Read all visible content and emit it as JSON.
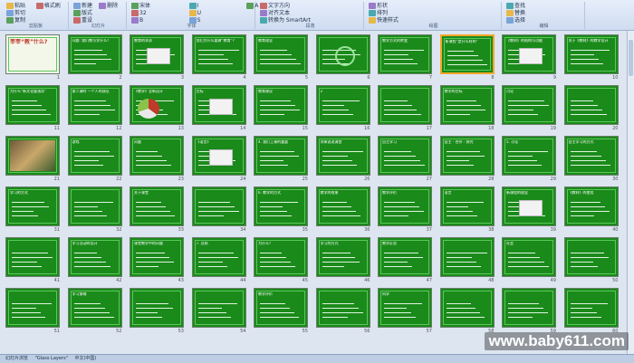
{
  "ribbon": {
    "groups": [
      {
        "label": "剪贴板",
        "buttons": [
          "粘贴",
          "剪切",
          "复制",
          "格式刷"
        ]
      },
      {
        "label": "幻灯片",
        "buttons": [
          "新建",
          "版式",
          "重设",
          "删除"
        ]
      },
      {
        "label": "字体",
        "buttons": [
          "宋体",
          "32",
          "B",
          "I",
          "U",
          "S",
          "A"
        ]
      },
      {
        "label": "段落",
        "buttons": [
          "文字方向",
          "对齐文本",
          "转换为 SmartArt"
        ]
      },
      {
        "label": "绘图",
        "buttons": [
          "形状",
          "排列",
          "快速样式"
        ]
      },
      {
        "label": "编辑",
        "buttons": [
          "查找",
          "替换",
          "选择"
        ]
      }
    ]
  },
  "slides": [
    {
      "n": "1",
      "t": "莘莘“教”什么?",
      "v": "title"
    },
    {
      "n": "2",
      "t": "问题: 我们教与学什么?",
      "v": "text"
    },
    {
      "n": "3",
      "t": "教育的本质",
      "v": "diagram"
    },
    {
      "n": "4",
      "t": "我们为什么要做“教育”?",
      "v": "text"
    },
    {
      "n": "5",
      "t": "教育理念",
      "v": "text"
    },
    {
      "n": "6",
      "t": "",
      "v": "circle"
    },
    {
      "n": "7",
      "t": "教学方式的转变",
      "v": "text"
    },
    {
      "n": "8",
      "t": "新课程“是什么样的”",
      "v": "text"
    },
    {
      "n": "9",
      "t": "《教材》的结构与功能",
      "v": "diagram"
    },
    {
      "n": "10",
      "t": "关于《教材》的教学设计",
      "v": "text"
    },
    {
      "n": "11",
      "t": "为什么“新文化要落实”",
      "v": "text"
    },
    {
      "n": "12",
      "t": "第二课时 一个人的成长",
      "v": "text"
    },
    {
      "n": "13",
      "t": "《教学》全新设计",
      "v": "pie"
    },
    {
      "n": "14",
      "t": "目标",
      "v": "blocks"
    },
    {
      "n": "15",
      "t": "教育建议",
      "v": "text"
    },
    {
      "n": "16",
      "t": "2",
      "v": "text"
    },
    {
      "n": "17",
      "t": "",
      "v": "text"
    },
    {
      "n": "18",
      "t": "教学的目标",
      "v": "text"
    },
    {
      "n": "19",
      "t": "讨论",
      "v": "text"
    },
    {
      "n": "20",
      "t": "",
      "v": "text"
    },
    {
      "n": "21",
      "t": "",
      "v": "photo"
    },
    {
      "n": "22",
      "t": "游戏",
      "v": "text"
    },
    {
      "n": "23",
      "t": "问题",
      "v": "text"
    },
    {
      "n": "24",
      "t": "《语言》",
      "v": "blocks"
    },
    {
      "n": "25",
      "t": "4. 我们上课的重要",
      "v": "text"
    },
    {
      "n": "26",
      "t": "你来说说课堂",
      "v": "text"
    },
    {
      "n": "27",
      "t": "自主学习",
      "v": "text"
    },
    {
      "n": "28",
      "t": "自主 - 合作 - 探究",
      "v": "text"
    },
    {
      "n": "29",
      "t": "5. 讨论",
      "v": "text"
    },
    {
      "n": "30",
      "t": "自主学习的方式",
      "v": "text"
    },
    {
      "n": "31",
      "t": "学习的方式",
      "v": "text"
    },
    {
      "n": "32",
      "t": "",
      "v": "text"
    },
    {
      "n": "33",
      "t": "关于课堂",
      "v": "text"
    },
    {
      "n": "34",
      "t": "",
      "v": "text"
    },
    {
      "n": "35",
      "t": "6. 教学的方式",
      "v": "text"
    },
    {
      "n": "36",
      "t": "教学的效果",
      "v": "text"
    },
    {
      "n": "37",
      "t": "教学评价",
      "v": "text"
    },
    {
      "n": "38",
      "t": "语言",
      "v": "text"
    },
    {
      "n": "39",
      "t": "新课程的理念",
      "v": "diagram"
    },
    {
      "n": "40",
      "t": "《教材》的使用",
      "v": "text"
    },
    {
      "n": "41",
      "t": "",
      "v": "text"
    },
    {
      "n": "42",
      "t": "学习活动的设计",
      "v": "text"
    },
    {
      "n": "43",
      "t": "课堂教学中的问题",
      "v": "text"
    },
    {
      "n": "44",
      "t": "7. 总结",
      "v": "text"
    },
    {
      "n": "45",
      "t": "为什么?",
      "v": "text"
    },
    {
      "n": "46",
      "t": "学习的方式",
      "v": "text"
    },
    {
      "n": "47",
      "t": "教学反思",
      "v": "text"
    },
    {
      "n": "48",
      "t": "",
      "v": "text"
    },
    {
      "n": "49",
      "t": "社会",
      "v": "text"
    },
    {
      "n": "50",
      "t": "",
      "v": "text"
    },
    {
      "n": "51",
      "t": "",
      "v": "text"
    },
    {
      "n": "52",
      "t": "学习策略",
      "v": "text"
    },
    {
      "n": "53",
      "t": "",
      "v": "text"
    },
    {
      "n": "54",
      "t": "",
      "v": "text"
    },
    {
      "n": "55",
      "t": "教学评价",
      "v": "text"
    },
    {
      "n": "56",
      "t": "",
      "v": "text"
    },
    {
      "n": "57",
      "t": "科学",
      "v": "text"
    },
    {
      "n": "58",
      "t": "",
      "v": "text"
    },
    {
      "n": "59",
      "t": "",
      "v": "text"
    },
    {
      "n": "60",
      "t": "",
      "v": "text"
    },
    {
      "n": "61",
      "t": "",
      "v": "text"
    },
    {
      "n": "62",
      "t": "",
      "v": "text"
    },
    {
      "n": "63",
      "t": "",
      "v": "text"
    },
    {
      "n": "64",
      "t": "",
      "v": "text"
    },
    {
      "n": "65",
      "t": "",
      "v": "text"
    },
    {
      "n": "66",
      "t": "",
      "v": "text"
    },
    {
      "n": "67",
      "t": "",
      "v": "text"
    },
    {
      "n": "68",
      "t": "",
      "v": "text"
    },
    {
      "n": "69",
      "t": "",
      "v": "text"
    },
    {
      "n": "70",
      "t": "",
      "v": "text"
    }
  ],
  "selected_slide": "8",
  "status": {
    "view": "幻灯片浏览",
    "theme": "\"Glass Layers\"",
    "language": "中文(中国)"
  },
  "watermark": "www.baby611.com",
  "colors": {
    "slide_bg": "#1a8a1a",
    "selection": "#f6a72b"
  }
}
